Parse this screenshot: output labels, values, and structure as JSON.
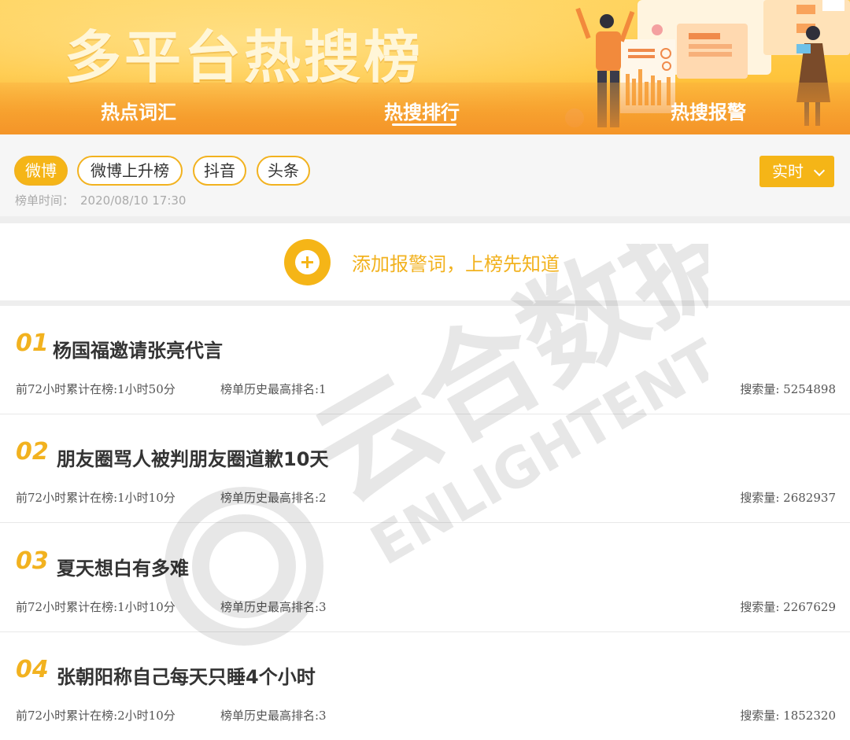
{
  "banner": {
    "title": "多平台热搜榜",
    "tabs": [
      {
        "label": "热点词汇"
      },
      {
        "label": "热搜排行"
      },
      {
        "label": "热搜报警"
      }
    ]
  },
  "filter": {
    "platforms": [
      {
        "label": "微博",
        "active": true
      },
      {
        "label": "微博上升榜",
        "active": false
      },
      {
        "label": "抖音",
        "active": false
      },
      {
        "label": "头条",
        "active": false
      }
    ],
    "time_select": "实时",
    "list_time_label": "榜单时间：",
    "list_time_value": "2020/08/10 17:30"
  },
  "add_alert": {
    "text": "添加报警词，上榜先知道"
  },
  "rankings": [
    {
      "rank": "01",
      "title": "杨国福邀请张亮代言",
      "hours": "前72小时累计在榜:1小时50分",
      "best": "榜单历史最高排名:1",
      "volume": "搜索量: 5254898"
    },
    {
      "rank": "02",
      "title": "朋友圈骂人被判朋友圈道歉10天",
      "hours": "前72小时累计在榜:1小时10分",
      "best": "榜单历史最高排名:2",
      "volume": "搜索量: 2682937"
    },
    {
      "rank": "03",
      "title": "夏天想白有多难",
      "hours": "前72小时累计在榜:1小时10分",
      "best": "榜单历史最高排名:3",
      "volume": "搜索量: 2267629"
    },
    {
      "rank": "04",
      "title": "张朝阳称自己每天只睡4个小时",
      "hours": "前72小时累计在榜:2小时10分",
      "best": "榜单历史最高排名:3",
      "volume": "搜索量: 1852320"
    }
  ],
  "watermark": {
    "text_cn": "云合数据",
    "text_en": "ENLIGHTENT"
  },
  "colors": {
    "accent": "#f5b517",
    "banner_top": "#ffd25a",
    "banner_bottom": "#f7a62e"
  }
}
